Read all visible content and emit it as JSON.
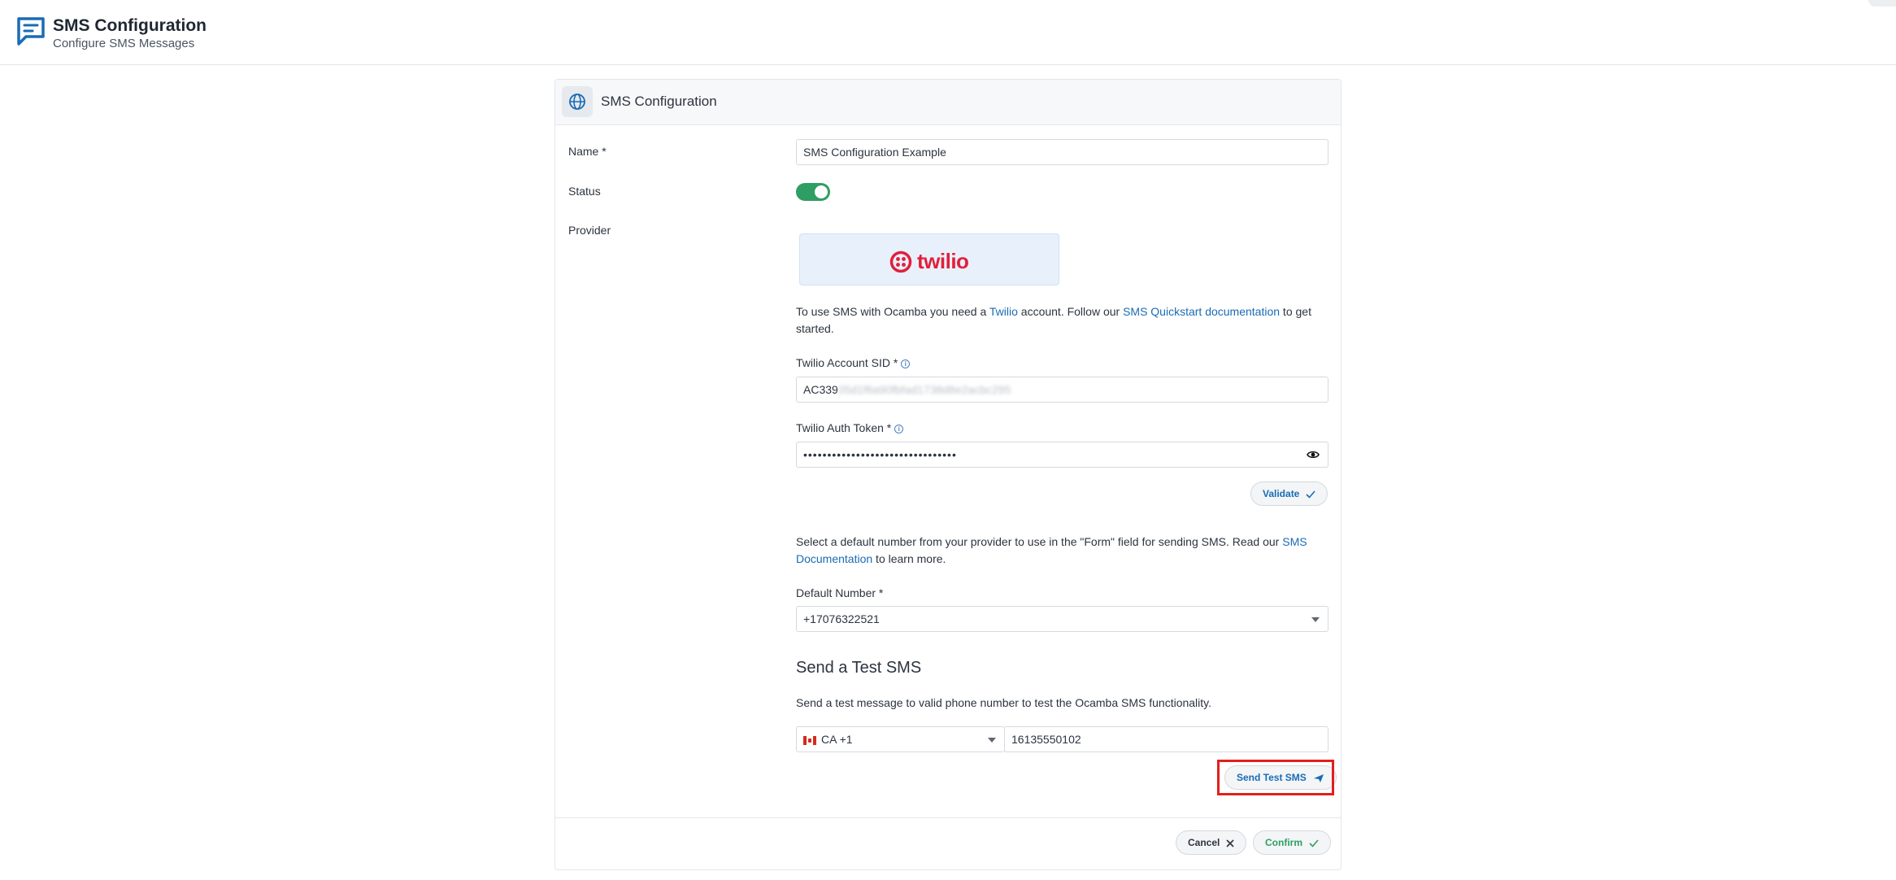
{
  "header": {
    "title": "SMS Configuration",
    "subtitle": "Configure SMS Messages"
  },
  "card": {
    "title": "SMS Configuration",
    "name_label": "Name *",
    "name_value": "SMS Configuration Example",
    "status_label": "Status",
    "status_on": true,
    "provider_label": "Provider",
    "provider_logo": "twilio",
    "intro": {
      "p1": "To use SMS with Ocamba you need a ",
      "link1": "Twilio",
      "p2": " account. Follow our ",
      "link2": "SMS Quickstart documentation",
      "p3": " to get started."
    },
    "sid_label": "Twilio Account SID *",
    "sid_prefix": "AC339",
    "sid_rest": "05d1f6a90fbfad1738d8e2acbc295",
    "token_label": "Twilio Auth Token *",
    "token_value": "••••••••••••••••••••••••••••••••",
    "validate_label": "Validate",
    "number_info": {
      "p1": "Select a default number from your provider to use in the \"Form\" field for sending SMS. Read our ",
      "link": "SMS Documentation",
      "p2": " to learn more."
    },
    "default_number_label": "Default Number *",
    "default_number_value": "+17076322521",
    "test_title": "Send a Test SMS",
    "test_desc": "Send a test message to valid phone number to test the Ocamba SMS functionality.",
    "country_code": "CA +1",
    "test_phone": "16135550102",
    "send_test_label": "Send Test SMS",
    "cancel_label": "Cancel",
    "confirm_label": "Confirm"
  },
  "colors": {
    "accent": "#1a6bb5",
    "toggle_on": "#2e9e62",
    "twilio_red": "#e31e3b",
    "highlight": "#e0201c"
  }
}
